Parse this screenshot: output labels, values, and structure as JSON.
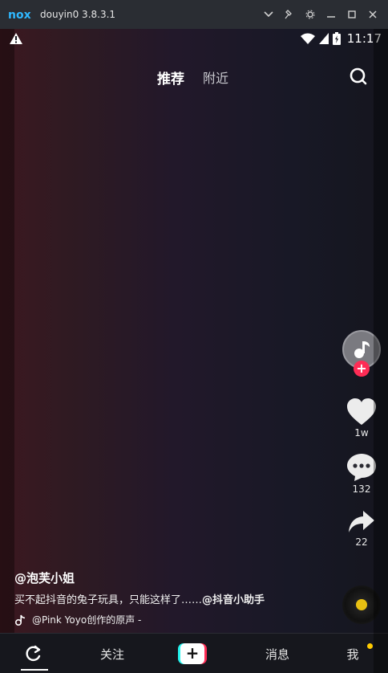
{
  "window": {
    "logo": "nox",
    "title": "douyin0 3.8.3.1",
    "icons": [
      "chevron-down-icon",
      "pin-icon",
      "gear-icon",
      "minimize-icon",
      "maximize-icon",
      "close-icon"
    ]
  },
  "statusbar": {
    "time": "11:17",
    "icons": [
      "warning-icon",
      "wifi-icon",
      "signal-icon",
      "battery-icon"
    ]
  },
  "top_tabs": {
    "recommended": "推荐",
    "nearby": "附近"
  },
  "rail": {
    "likes": "1w",
    "comments": "132",
    "shares": "22"
  },
  "video": {
    "author": "@泡芙小姐",
    "caption_text": "买不起抖音的兔子玩具，只能这样了……",
    "caption_mention": "@抖音小助手",
    "music": "@Pink Yoyo创作的原声 -"
  },
  "bottom_nav": {
    "follow": "关注",
    "create": "+",
    "messages": "消息",
    "me": "我"
  },
  "colors": {
    "accent_red": "#fe2c55",
    "accent_cyan": "#25f4ee",
    "notify_dot": "#ffcb00"
  }
}
